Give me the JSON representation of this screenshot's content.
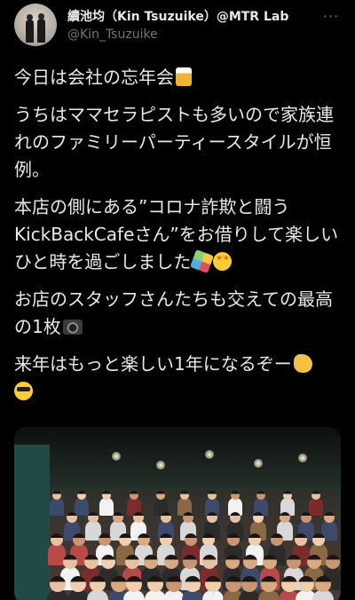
{
  "user": {
    "display_name": "續池均（Kin Tsuzuike）@MTR Lab",
    "handle": "@Kin_Tsuzuike"
  },
  "more_icon": "more-horizontal-icon",
  "tweet": {
    "p1": "今日は会社の忘年会",
    "p2": "うちはママセラピストも多いので家族連れのファミリーパーティースタイルが恒例。",
    "p3": "本店の側にある”コロナ詐欺と闘うKickBackCafeさん”をお借りして楽しいひと時を過ごしました",
    "p4": "お店のスタッフさんたちも交えての最高の1枚",
    "p5": "来年はもっと楽しい1年になるぞー"
  },
  "emoji": {
    "p1": "beer-mugs-emoji",
    "p3a": "party-popper-emoji",
    "p3b": "star-struck-emoji",
    "p4": "camera-flash-emoji",
    "p5a": "call-me-hand-emoji",
    "p5b": "sunglasses-emoji"
  },
  "colors": {
    "background": "#000000",
    "text": "#e7e9ea",
    "secondary_text": "#71767b"
  },
  "photo": {
    "subject": "group-photo"
  }
}
